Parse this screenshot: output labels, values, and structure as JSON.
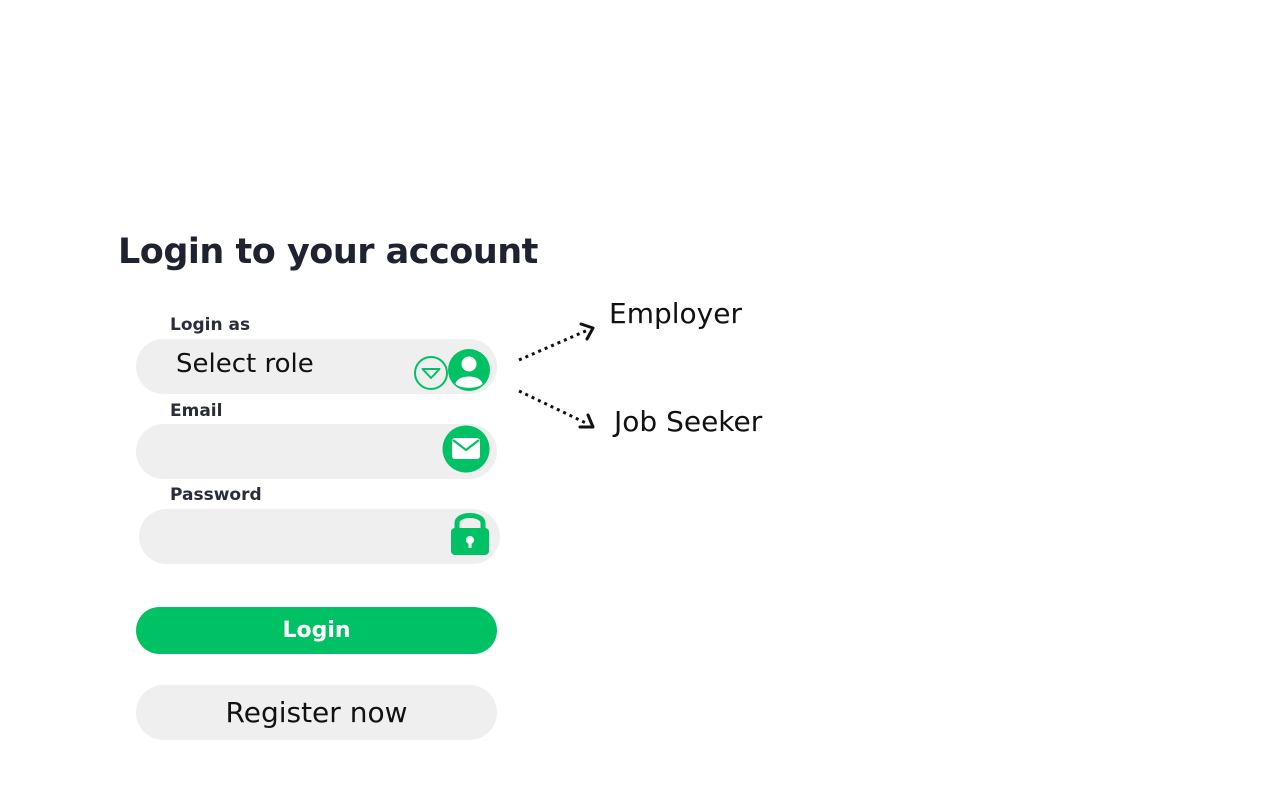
{
  "page": {
    "title": "Login to your account"
  },
  "role": {
    "label": "Login as",
    "value": "Select role"
  },
  "email": {
    "label": "Email",
    "value": ""
  },
  "password": {
    "label": "Password",
    "value": ""
  },
  "buttons": {
    "login": "Login",
    "register": "Register now"
  },
  "role_options": [
    "Employer",
    "Job Seeker"
  ],
  "icons": {
    "dropdown": "chevron-down-icon",
    "role": "user-icon",
    "email": "mail-icon",
    "password": "lock-icon"
  },
  "colors": {
    "accent": "#00c163",
    "field_bg": "#efefef",
    "text": "#1f2230"
  }
}
